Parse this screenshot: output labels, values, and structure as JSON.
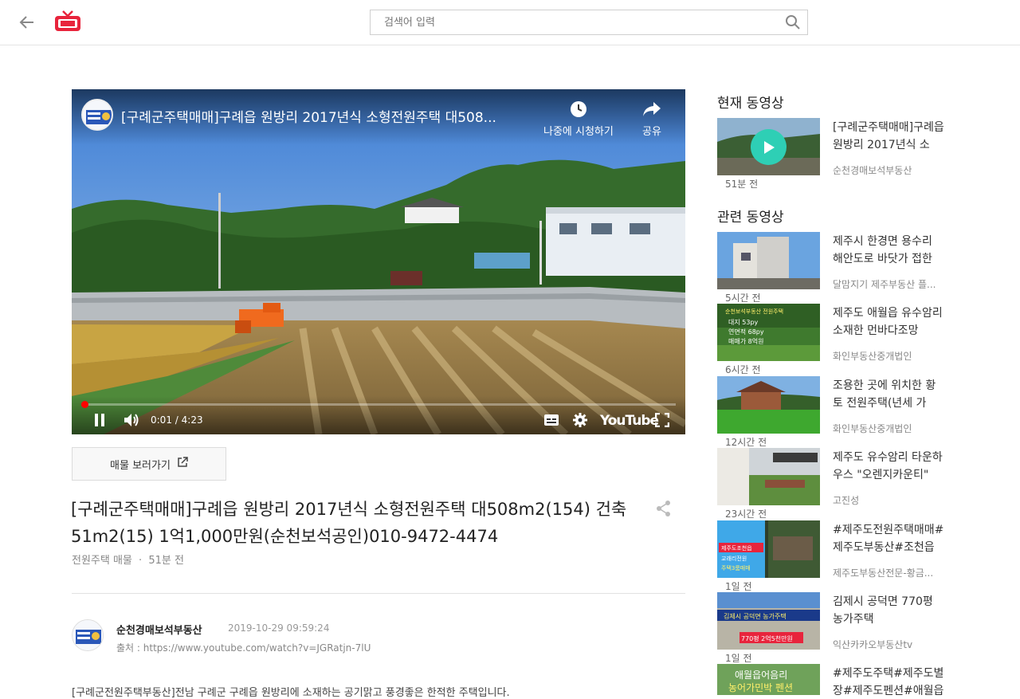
{
  "header": {
    "search_placeholder": "검색어 입력"
  },
  "player": {
    "title": "[구례군주택매매]구례읍 원방리 2017년식 소형전원주택 대508...",
    "watch_later_label": "나중에 시청하기",
    "share_label": "공유",
    "current_time": "0:01",
    "duration": "4:23",
    "time_separator": "/",
    "progress": 0.004,
    "youtube_label": "YouTube"
  },
  "link_button": {
    "label": "매물 보러가기"
  },
  "video": {
    "title": "[구례군주택매매]구례읍 원방리 2017년식 소형전원주택 대508m2(154) 건축51m2(15) 1억1,000만원(순천보석공인)010-9472-4474",
    "category": "전원주택 매물",
    "dot": "·",
    "age": "51분 전"
  },
  "author": {
    "name": "순천경매보석부동산",
    "date": "2019-10-29 09:59:24",
    "source": "출처 : https://www.youtube.com/watch?v=JGRatjn-7lU"
  },
  "description": "[구례군전원주택부동산]전남 구례군 구례읍 원방리에 소재하는 공기맑고 풍경좋은 한적한 주택입니다.",
  "sidebar": {
    "current_heading": "현재 동영상",
    "current": {
      "title": "[구례군주택매매]구례읍 원방리 2017년식 소",
      "channel": "순천경매보석부동산",
      "time": "51분 전"
    },
    "related_heading": "관련 동영상",
    "related": [
      {
        "title": "제주시 한경면 용수리 해안도로 바닷가 접한",
        "channel": "달맘지기 제주부동산 플...",
        "time": "5시간 전"
      },
      {
        "title": "제주도 애월읍 유수암리 소재한 먼바다조망",
        "channel": "화인부동산중개법인",
        "time": "6시간 전"
      },
      {
        "title": "조용한 곳에 위치한 황토 전원주택(년세 가",
        "channel": "화인부동산중개법인",
        "time": "12시간 전"
      },
      {
        "title": "제주도 유수암리 타운하우스 \"오렌지카운티\"",
        "channel": "고진성",
        "time": "23시간 전"
      },
      {
        "title": "#제주도전원주택매매#제주도부동산#조천읍",
        "channel": "제주도부동산전문-황금...",
        "time": "1일 전"
      },
      {
        "title": "김제시 공덕면 770평 농가주택",
        "channel": "익산카카오부동산tv",
        "time": "1일 전"
      },
      {
        "title": "#제주도주택#제주도별장#제주도펜션#애월읍",
        "channel": "",
        "time": ""
      }
    ],
    "thumb_texts": {
      "t2": [
        "순천보석부동산 전원주택",
        "대지 53py",
        "연면적 68py",
        "매매가 8억원"
      ],
      "t5a": [
        "제주도조천읍",
        "교래리전원",
        "주택3룸매매"
      ],
      "t6": [
        "김제시 공덕면 농가주택",
        "770평 2억5천만원"
      ],
      "t7": [
        "애월읍어음리",
        "농어가민박 펜션"
      ]
    }
  },
  "colors": {
    "accent_play": "#2ecfb5",
    "progress": "#ff0000",
    "logo_red": "#e8243c"
  }
}
